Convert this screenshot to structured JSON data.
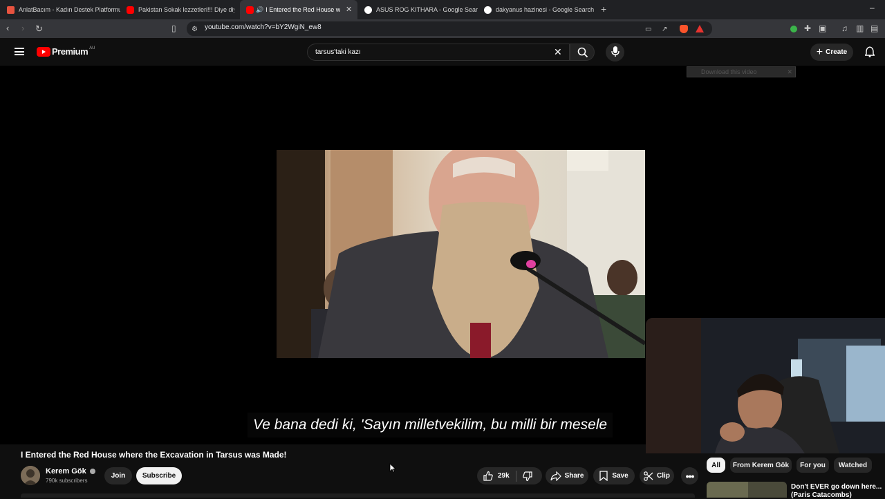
{
  "browser": {
    "tabs": [
      {
        "title": "AnlatBacım - Kadın Destek Platformu",
        "color": "#e8533f"
      },
      {
        "title": "Pakistan Sokak lezzetleri!!! Diye diye",
        "color": "#ff0000"
      },
      {
        "title": "I Entered the Red House where",
        "color": "#ff0000"
      },
      {
        "title": "ASUS ROG KITHARA - Google Search",
        "color": "#ffffff"
      },
      {
        "title": "dakyanus hazinesi - Google Search",
        "color": "#ffffff"
      }
    ],
    "new_tab": "+",
    "minimize": "–",
    "url": "youtube.com/watch?v=bY2WgiN_ew8"
  },
  "youtube": {
    "logo_text": "Premium",
    "region": "AU",
    "search_value": "tarsus'taki kazı",
    "create_label": "Create"
  },
  "player": {
    "subtitle": "Ve bana dedi ki, 'Sayın milletvekilim, bu milli bir mesele",
    "download_bar": "Download this video"
  },
  "video": {
    "title": "I Entered the Red House where the Excavation in Tarsus was Made!",
    "channel": "Kerem Gök",
    "subscribers": "790k subscribers",
    "join_label": "Join",
    "subscribe_label": "Subscribe",
    "likes": "29k",
    "share_label": "Share",
    "save_label": "Save",
    "clip_label": "Clip"
  },
  "chips": [
    "All",
    "From Kerem Gök",
    "For you",
    "Watched"
  ],
  "recommendation": {
    "title": "Don't EVER go down here...",
    "subtitle": "(Paris Catacombs)"
  }
}
